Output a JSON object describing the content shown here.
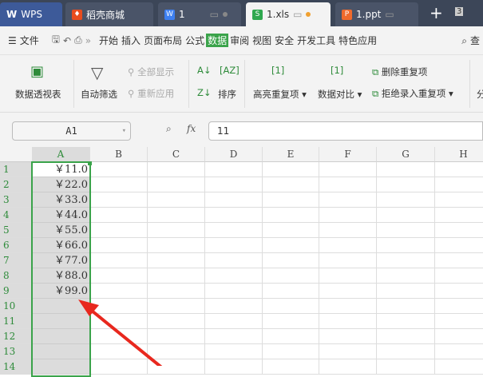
{
  "tabs": [
    {
      "label": "WPS",
      "icon": "wps-logo-icon"
    },
    {
      "label": "稻壳商城",
      "icon": "docer-icon"
    },
    {
      "label": "1",
      "icon": "writer-doc-icon"
    },
    {
      "label": "1.xls",
      "icon": "spreadsheet-icon"
    },
    {
      "label": "1.ppt",
      "icon": "presentation-icon"
    }
  ],
  "tab_count": "3",
  "menu": {
    "file": "文件",
    "items": [
      "开始",
      "插入",
      "页面布局",
      "公式",
      "数据",
      "审阅",
      "视图",
      "安全",
      "开发工具",
      "特色应用"
    ],
    "active": "数据",
    "search": "查"
  },
  "ribbon": {
    "pivot": "数据透视表",
    "autofilter": "自动筛选",
    "show_all": "全部显示",
    "reapply": "重新应用",
    "sort": "排序",
    "highlight_dup": "高亮重复项",
    "compare": "数据对比",
    "remove_dup": "删除重复项",
    "reject_dup": "拒绝录入重复项",
    "split": "分"
  },
  "formula": {
    "name_box": "A1",
    "fx": "fx",
    "value": "11"
  },
  "columns": [
    "A",
    "B",
    "C",
    "D",
    "E",
    "F",
    "G",
    "H"
  ],
  "rows": [
    "1",
    "2",
    "3",
    "4",
    "5",
    "6",
    "7",
    "8",
    "9",
    "10",
    "11",
    "12",
    "13",
    "14"
  ],
  "cells_a": [
    "￥11.0",
    "￥22.0",
    "￥33.0",
    "￥44.0",
    "￥55.0",
    "￥66.0",
    "￥77.0",
    "￥88.0",
    "￥99.0"
  ],
  "colors": {
    "accent": "#3aa34a",
    "arrow": "#e8281e"
  }
}
